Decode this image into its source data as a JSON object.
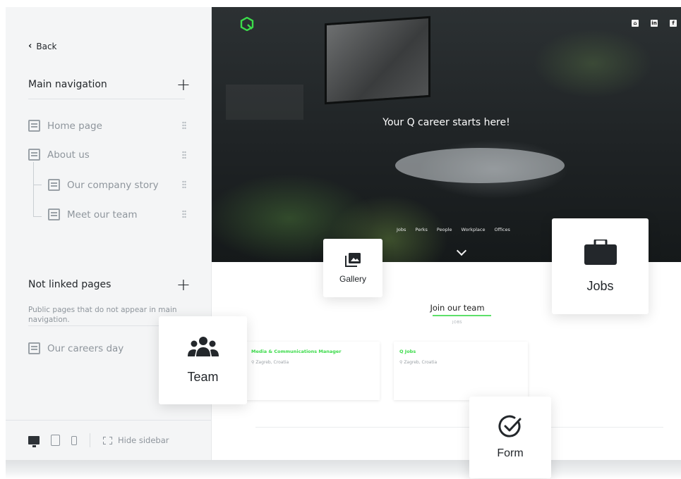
{
  "sidebar": {
    "back_label": "Back",
    "main_nav": {
      "title": "Main navigation",
      "add_symbol": "+",
      "items": [
        {
          "label": "Home page"
        },
        {
          "label": "About us"
        },
        {
          "label": "Our company story"
        },
        {
          "label": "Meet our team"
        }
      ]
    },
    "not_linked": {
      "title": "Not linked pages",
      "add_symbol": "+",
      "description": "Public pages that do not appear in main navigation.",
      "items": [
        {
          "label": "Our careers day"
        }
      ]
    },
    "footer": {
      "hide_label": "Hide sidebar"
    }
  },
  "site": {
    "hero_title": "Your Q career starts here!",
    "nav": [
      "Jobs",
      "Perks",
      "People",
      "Workplace",
      "Offices"
    ],
    "join_title": "Join our team",
    "join_sub": "JOBS",
    "jobs": [
      {
        "title": "Media & Communications Manager",
        "location": "Zagreb, Croatia"
      },
      {
        "title": "Q Jobs",
        "location": "Zagreb, Croatia"
      }
    ],
    "social_icons": [
      "home-icon",
      "linkedin-icon",
      "facebook-icon"
    ],
    "accent": "#3bdb4a"
  },
  "cards": {
    "gallery": "Gallery",
    "jobs": "Jobs",
    "team": "Team",
    "form": "Form"
  }
}
